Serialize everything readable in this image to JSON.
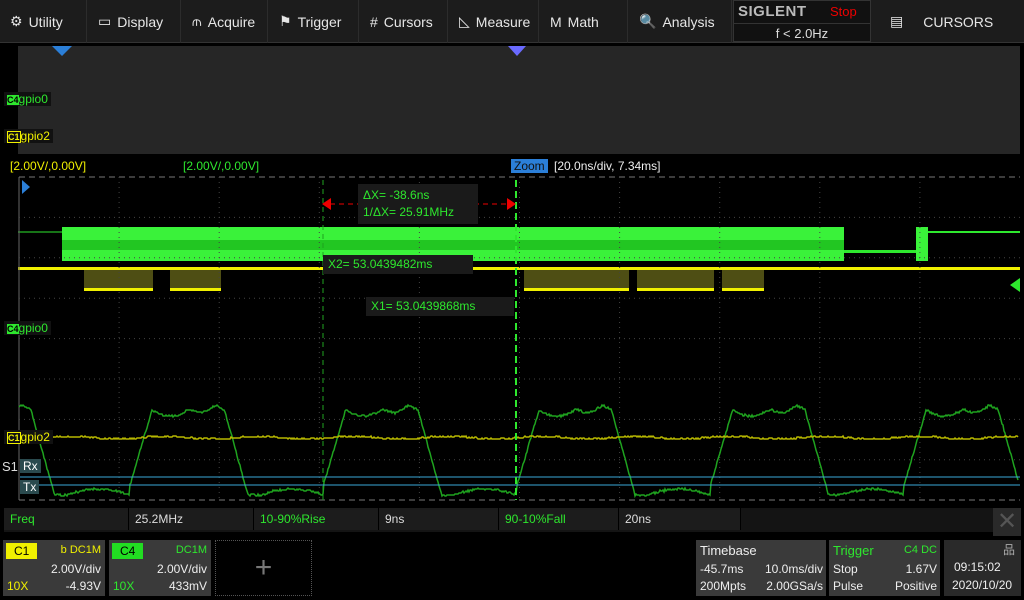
{
  "menu": [
    {
      "label": "Utility",
      "icon": "gear-icon"
    },
    {
      "label": "Display",
      "icon": "monitor-icon"
    },
    {
      "label": "Acquire",
      "icon": "acquire-icon"
    },
    {
      "label": "Trigger",
      "icon": "flag-icon"
    },
    {
      "label": "Cursors",
      "icon": "hash-icon"
    },
    {
      "label": "Measure",
      "icon": "ruler-icon"
    },
    {
      "label": "Math",
      "icon": "math-icon"
    },
    {
      "label": "Analysis",
      "icon": "analysis-icon"
    }
  ],
  "brand": {
    "logo": "SIGLENT",
    "state": "Stop",
    "trigger_freq": "f < 2.0Hz"
  },
  "panel": {
    "label": "CURSORS",
    "icon": "list-icon"
  },
  "overview": {
    "ch4_label": "gpio0",
    "ch1_label": "gpio2"
  },
  "scale": {
    "c1": "[2.00V/,0.00V]",
    "c4": "[2.00V/,0.00V]",
    "zoom_label": "Zoom",
    "zoom_info": "[20.0ns/div, 7.34ms]"
  },
  "cursors": {
    "dx": "ΔX= -38.6ns",
    "inv_dx": "1/ΔX= 25.91MHz",
    "x2": "X2= 53.0439482ms",
    "x1": "X1= 53.0439868ms"
  },
  "channels": {
    "gpio0": "gpio0",
    "gpio2": "gpio2",
    "serial": "S1",
    "rx": "Rx",
    "tx": "Tx"
  },
  "measure": [
    {
      "name": "Freq",
      "value": "25.2MHz"
    },
    {
      "name": "10-90%Rise",
      "value": "9ns"
    },
    {
      "name": "90-10%Fall",
      "value": "20ns"
    }
  ],
  "c1": {
    "tag": "C1",
    "coupling": "b DC1M",
    "scale": "2.00V/div",
    "probe": "10X",
    "offset": "-4.93V",
    "color": "#f0f000"
  },
  "c4": {
    "tag": "C4",
    "coupling": "DC1M",
    "scale": "2.00V/div",
    "probe": "10X",
    "offset": "433mV",
    "color": "#22dd22"
  },
  "timebase": {
    "title": "Timebase",
    "delay": "-45.7ms",
    "scale": "10.0ms/div",
    "memory": "200Mpts",
    "rate": "2.00GSa/s"
  },
  "trigger": {
    "title": "Trigger",
    "source": "C4 DC",
    "state": "Stop",
    "level": "1.67V",
    "type": "Pulse",
    "polarity": "Positive"
  },
  "clock": {
    "time": "09:15:02",
    "date": "2020/10/20"
  }
}
